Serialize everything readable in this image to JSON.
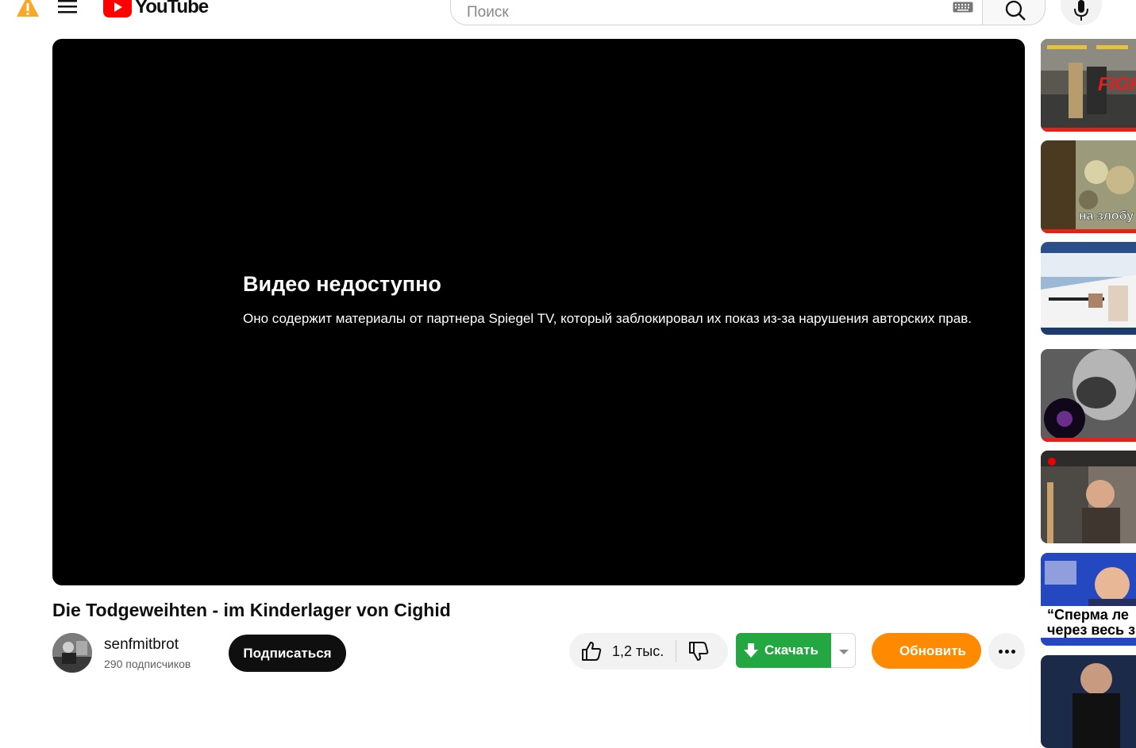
{
  "header": {
    "logo_text": "YouTube",
    "search_placeholder": "Поиск",
    "icons": [
      "warning-icon",
      "menu-icon",
      "keyboard-icon",
      "search-icon",
      "mic-icon"
    ],
    "warning_color": "#f9a825"
  },
  "player": {
    "error_title": "Видео недоступно",
    "error_message": "Оно содержит материалы от партнера Spiegel TV, который заблокировал их показ из-за нарушения авторских прав."
  },
  "video": {
    "title": "Die Todgeweihten - im Kinderlager von Cighid",
    "channel_name": "senfmitbrot",
    "subscribers": "290 подписчиков",
    "subscribe_label": "Подписаться",
    "like_count": "1,2 тыс.",
    "download_label": "Скачать",
    "update_label": "Обновить"
  },
  "colors": {
    "accent_red": "#ff0000",
    "download_green": "#22a741",
    "update_orange": "#ff8a00"
  },
  "sidebar": {
    "thumbnails": [
      {
        "name": "fighting-game-thumbnail",
        "text": "FIGH"
      },
      {
        "name": "cartoon-thumbnail",
        "text": "на злобу"
      },
      {
        "name": "3d-game-thumbnail",
        "text": ""
      },
      {
        "name": "grayscale-art-thumbnail",
        "text": ""
      },
      {
        "name": "news-anchor-thumbnail",
        "text": ""
      },
      {
        "name": "political-thumbnail",
        "line1": "“Сперма ле",
        "line2": "через весь з"
      },
      {
        "name": "person-thumbnail",
        "text": ""
      }
    ]
  }
}
